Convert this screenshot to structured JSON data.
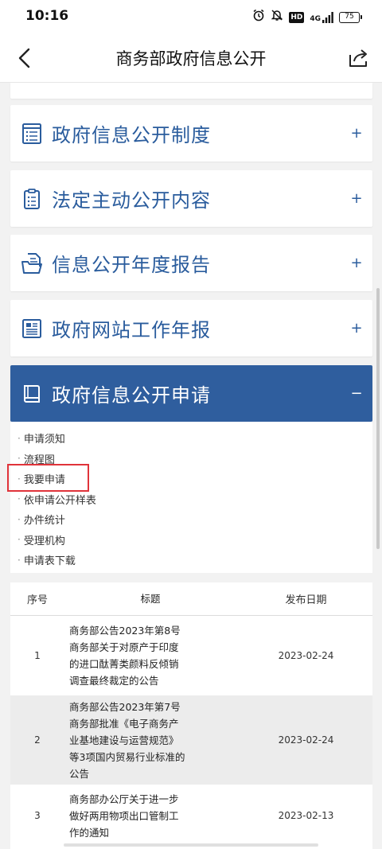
{
  "status": {
    "time": "10:16",
    "hd": "HD",
    "network": "4G",
    "battery": "75"
  },
  "nav": {
    "title": "商务部政府信息公开"
  },
  "sections": [
    {
      "label": "政府信息公开制度",
      "toggle": "+",
      "icon": "list-doc-icon"
    },
    {
      "label": "法定主动公开内容",
      "toggle": "+",
      "icon": "clipboard-icon"
    },
    {
      "label": "信息公开年度报告",
      "toggle": "+",
      "icon": "folder-doc-icon"
    },
    {
      "label": "政府网站工作年报",
      "toggle": "+",
      "icon": "newspaper-icon"
    },
    {
      "label": "政府信息公开申请",
      "toggle": "−",
      "icon": "book-icon"
    }
  ],
  "sub_items": [
    "申请须知",
    "流程图",
    "我要申请",
    "依申请公开样表",
    "办件统计",
    "受理机构",
    "申请表下载"
  ],
  "table": {
    "headers": {
      "index": "序号",
      "title": "标题",
      "date": "发布日期"
    },
    "rows": [
      {
        "index": "1",
        "title_lines": [
          "商务部公告2023年第8号",
          "商务部关于对原产于印度",
          "的进口酞菁类颜料反倾销",
          "调查最终裁定的公告"
        ],
        "date": "2023-02-24"
      },
      {
        "index": "2",
        "title_lines": [
          "商务部公告2023年第7号",
          "商务部批准《电子商务产",
          "业基地建设与运营规范》",
          "等3项国内贸易行业标准的",
          "公告"
        ],
        "date": "2023-02-24"
      },
      {
        "index": "3",
        "title_lines": [
          "商务部办公厅关于进一步",
          "做好两用物项出口管制工",
          "作的通知"
        ],
        "date": "2023-02-13"
      }
    ]
  },
  "colors": {
    "accent": "#2f5e9e",
    "section_text": "#2a5c9d",
    "highlight": "#e0333a"
  }
}
